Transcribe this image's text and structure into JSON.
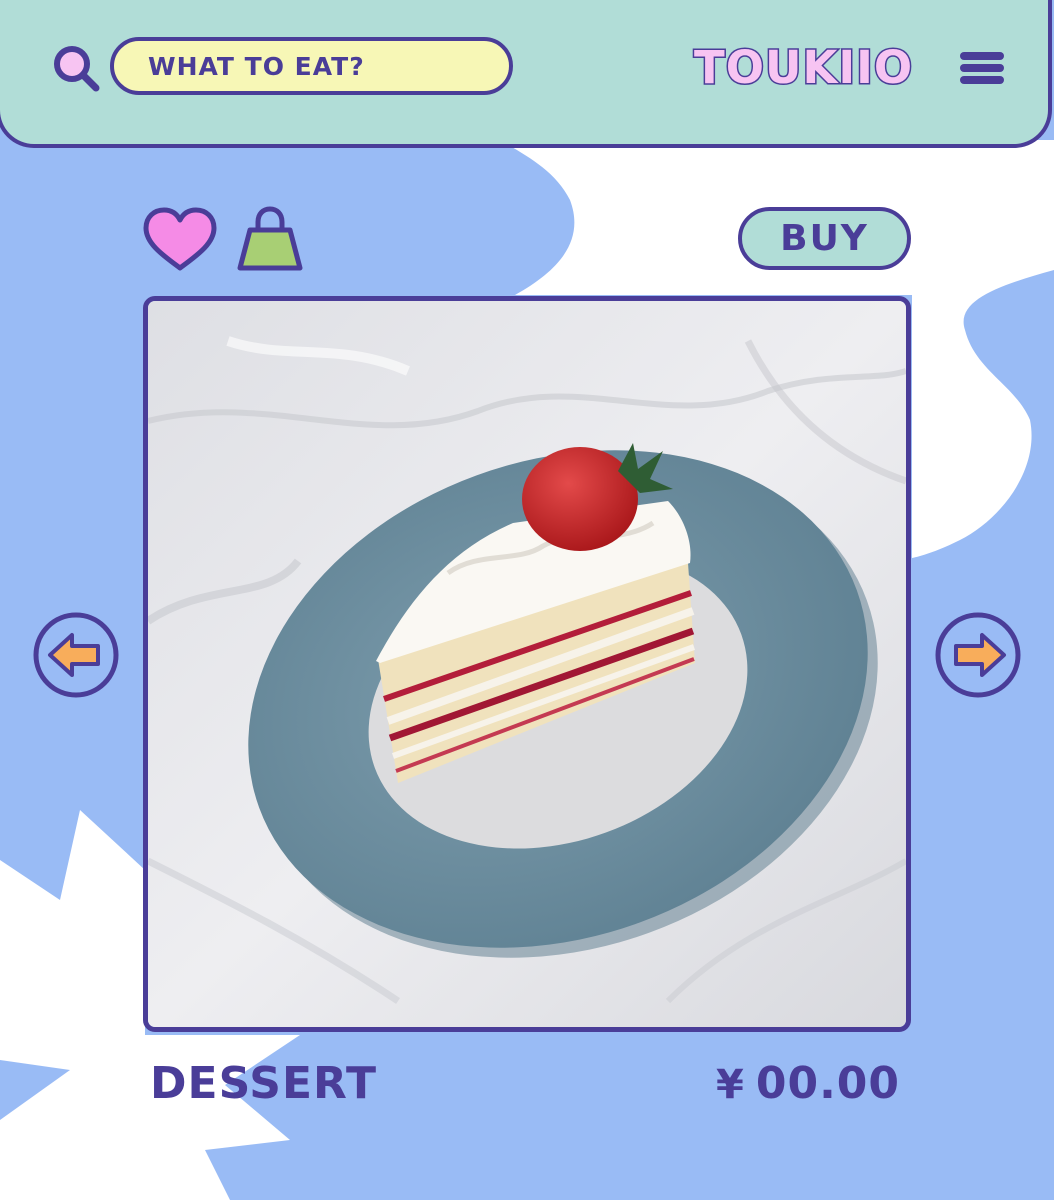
{
  "header": {
    "search_placeholder": "WHAT TO EAT?",
    "brand": "TOUKIIO",
    "icons": {
      "search": "search-icon",
      "menu": "menu-icon"
    }
  },
  "actions": {
    "buy_label": "BUY",
    "icons": {
      "favorite": "heart-icon",
      "cart": "shopping-bag-icon"
    }
  },
  "product": {
    "image_alt": "strawberry shortcake slice on a blue plate",
    "name": "DESSERT",
    "currency": "¥",
    "price": "00.00"
  },
  "navigation": {
    "prev": "arrow-left-icon",
    "next": "arrow-right-icon"
  },
  "colors": {
    "background_blue": "#99bbf5",
    "header_mint": "#b1ddd7",
    "search_yellow": "#f7f7b6",
    "brand_pink": "#f7c4f2",
    "outline_purple": "#4a3d98",
    "heart_pink": "#f58be6",
    "bag_green": "#a8cf74",
    "arrow_orange": "#f8ad5b"
  }
}
